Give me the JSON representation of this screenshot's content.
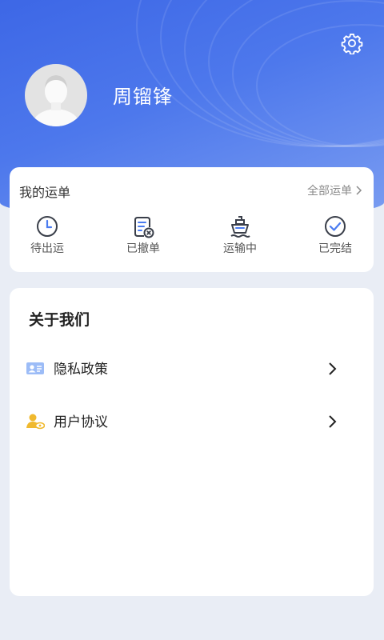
{
  "profile": {
    "name": "周镏锋",
    "avatar": "default-avatar"
  },
  "orders": {
    "title": "我的运单",
    "all_label": "全部运单",
    "items": [
      {
        "label": "待出运",
        "icon": "clock-icon"
      },
      {
        "label": "已撤单",
        "icon": "cancelled-doc-icon"
      },
      {
        "label": "运输中",
        "icon": "ship-icon"
      },
      {
        "label": "已完结",
        "icon": "check-circle-icon"
      }
    ]
  },
  "about": {
    "title": "关于我们",
    "items": [
      {
        "label": "隐私政策",
        "icon": "id-card-icon"
      },
      {
        "label": "用户协议",
        "icon": "user-agreement-icon"
      }
    ]
  },
  "colors": {
    "primary": "#3d67e6",
    "background": "#e9edf5",
    "icon_dark": "#3a3f4a",
    "icon_blue": "#4a7bf0",
    "icon_gold": "#f0b92e"
  }
}
